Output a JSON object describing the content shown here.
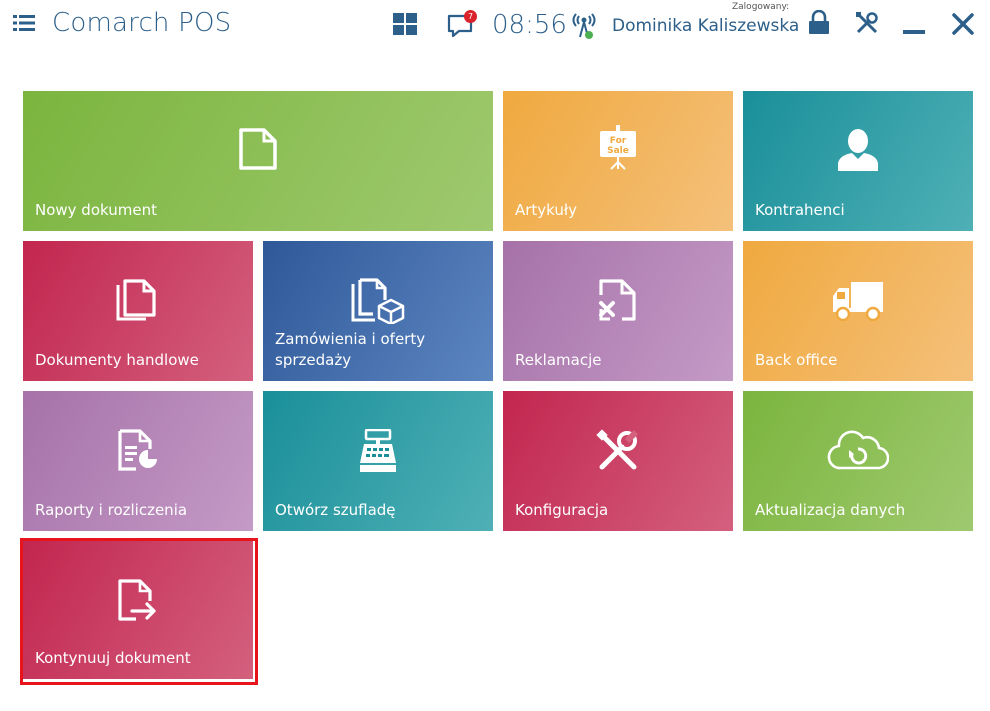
{
  "app": {
    "title": "Comarch POS"
  },
  "header": {
    "clock": "08:56",
    "logged_label": "Zalogowany:",
    "user_name": "Dominika Kaliszewska",
    "notifications_count": "7",
    "icons": [
      "menu-icon",
      "windows-icon",
      "notifications-icon",
      "signal-icon",
      "lock-icon",
      "tools-icon",
      "minimize-icon",
      "close-icon"
    ]
  },
  "tiles": [
    {
      "label": "Nowy dokument",
      "color": "#8bc24a",
      "icon": "new-document-icon"
    },
    {
      "label": "Artykuły",
      "color": "#f2ac4c",
      "icon": "for-sale-sign-icon",
      "sign": "For Sale"
    },
    {
      "label": "Kontrahenci",
      "color": "#2a9fa6",
      "icon": "person-icon"
    },
    {
      "label": "Dokumenty handlowe",
      "color": "#c9305d",
      "icon": "documents-icon"
    },
    {
      "label": "Zamówienia i oferty sprzedaży",
      "color": "#3e67a8",
      "icon": "orders-icon"
    },
    {
      "label": "Reklamacje",
      "color": "#b07fb4",
      "icon": "complaint-icon"
    },
    {
      "label": "Back office",
      "color": "#f2ac4c",
      "icon": "truck-icon"
    },
    {
      "label": "Raporty i rozliczenia",
      "color": "#b07fb4",
      "icon": "reports-icon"
    },
    {
      "label": "Otwórz szufladę",
      "color": "#2a9fa6",
      "icon": "cash-register-icon"
    },
    {
      "label": "Konfiguracja",
      "color": "#c9305d",
      "icon": "configuration-icon"
    },
    {
      "label": "Aktualizacja danych",
      "color": "#8bc24a",
      "icon": "cloud-sync-icon"
    },
    {
      "label": "Kontynuuj dokument",
      "color": "#c9305d",
      "icon": "continue-document-icon",
      "highlighted": true
    }
  ]
}
